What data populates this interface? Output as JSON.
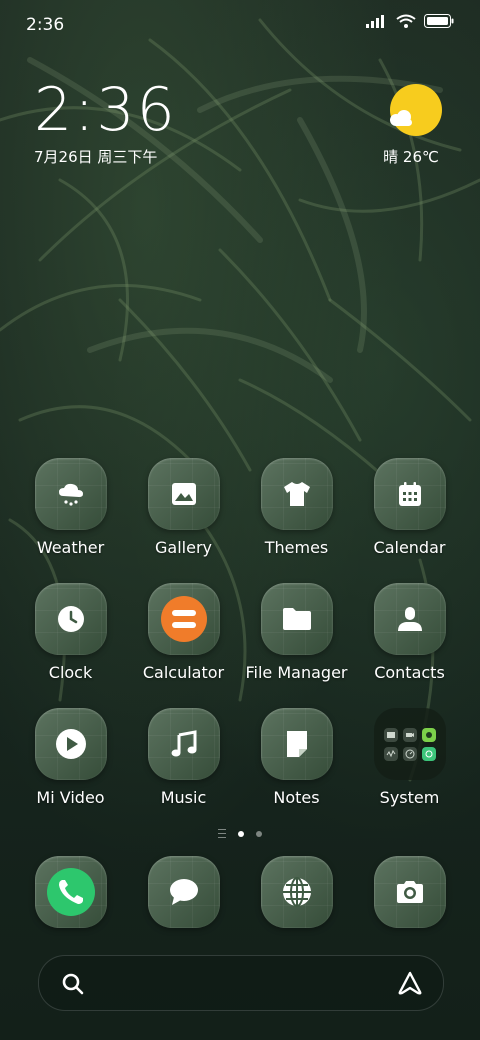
{
  "status_bar": {
    "time": "2:36"
  },
  "clock_widget": {
    "time": "2:36",
    "date": "7月26日 周三下午"
  },
  "weather_widget": {
    "text": "晴 26℃"
  },
  "apps": [
    {
      "label": "Weather",
      "icon": "weather-snow-icon"
    },
    {
      "label": "Gallery",
      "icon": "image-icon"
    },
    {
      "label": "Themes",
      "icon": "tshirt-icon"
    },
    {
      "label": "Calendar",
      "icon": "calendar-icon"
    },
    {
      "label": "Clock",
      "icon": "clock-icon"
    },
    {
      "label": "Calculator",
      "icon": "calculator-icon"
    },
    {
      "label": "File Manager",
      "icon": "folder-icon"
    },
    {
      "label": "Contacts",
      "icon": "person-icon"
    },
    {
      "label": "Mi Video",
      "icon": "play-icon"
    },
    {
      "label": "Music",
      "icon": "music-note-icon"
    },
    {
      "label": "Notes",
      "icon": "note-icon"
    },
    {
      "label": "System",
      "icon": "folder-grid-icon"
    }
  ],
  "page_indicator": {
    "pages": 2,
    "current": 1
  },
  "dock": [
    {
      "icon": "phone-icon"
    },
    {
      "icon": "message-icon"
    },
    {
      "icon": "browser-globe-icon"
    },
    {
      "icon": "camera-icon"
    }
  ],
  "colors": {
    "sun": "#f7cc1e",
    "calculator": "#f07c2a",
    "phone": "#2dc76d"
  }
}
